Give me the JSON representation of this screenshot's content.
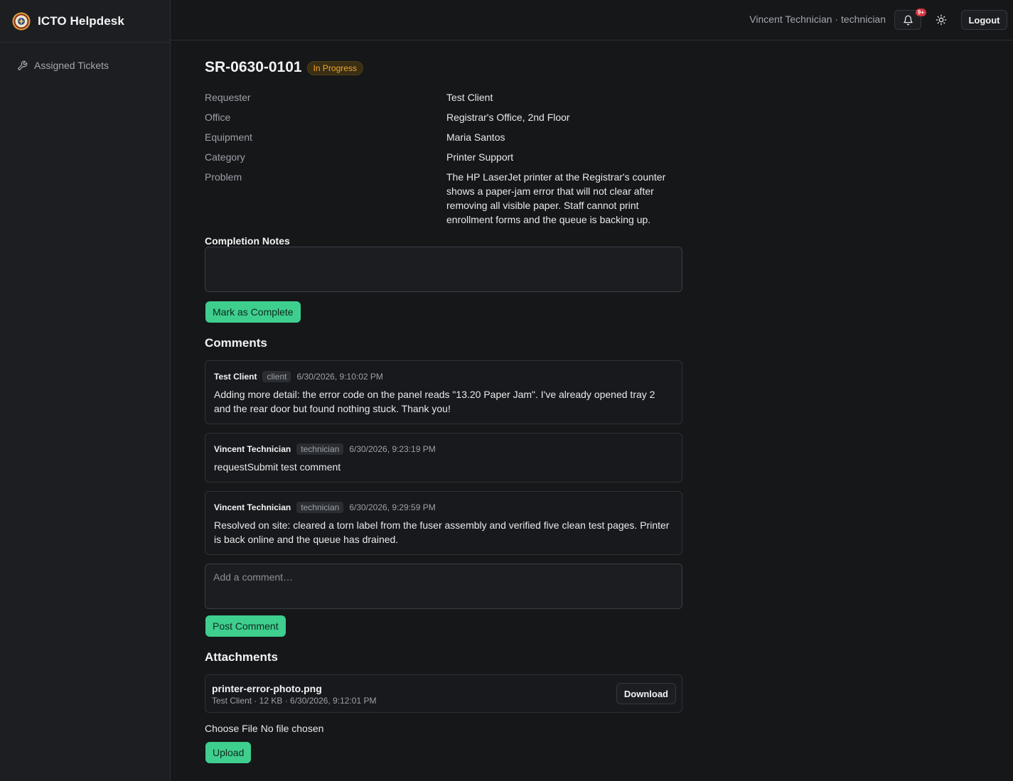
{
  "app": {
    "name": "ICTO Helpdesk"
  },
  "sidebar": {
    "items": [
      {
        "label": "Assigned Tickets",
        "icon": "wrench-icon"
      }
    ]
  },
  "header": {
    "user_label": "Vincent Technician · technician",
    "notification_badge": "9+",
    "logout_label": "Logout"
  },
  "ticket": {
    "id": "SR-0630-0101",
    "status": "In Progress",
    "status_color": "#f0a52b",
    "fields": [
      {
        "label": "Requester",
        "value": "Test Client"
      },
      {
        "label": "Office",
        "value": "Registrar's Office, 2nd Floor"
      },
      {
        "label": "Equipment",
        "value": "Maria Santos"
      },
      {
        "label": "Category",
        "value": "Printer Support"
      },
      {
        "label": "Problem",
        "value": "The HP LaserJet printer at the Registrar's counter shows a paper-jam error that will not clear after removing all visible paper. Staff cannot print enrollment forms and the queue is backing up."
      }
    ]
  },
  "completion": {
    "label": "Completion Notes",
    "value": "",
    "button_label": "Mark as Complete"
  },
  "comments": {
    "title": "Comments",
    "items": [
      {
        "author": "Test Client",
        "role": "client",
        "time": "6/30/2026, 9:10:02 PM",
        "body": "Adding more detail: the error code on the panel reads \"13.20 Paper Jam\". I've already opened tray 2 and the rear door but found nothing stuck. Thank you!"
      },
      {
        "author": "Vincent Technician",
        "role": "technician",
        "time": "6/30/2026, 9:23:19 PM",
        "body": "requestSubmit test comment"
      },
      {
        "author": "Vincent Technician",
        "role": "technician",
        "time": "6/30/2026, 9:29:59 PM",
        "body": "Resolved on site: cleared a torn label from the fuser assembly and verified five clean test pages. Printer is back online and the queue has drained."
      }
    ],
    "input_placeholder": "Add a comment…",
    "post_label": "Post Comment"
  },
  "attachments": {
    "title": "Attachments",
    "items": [
      {
        "name": "printer-error-photo.png",
        "meta": "Test Client · 12 KB · 6/30/2026, 9:12:01 PM",
        "download_label": "Download"
      }
    ],
    "choose_file_label": "Choose File",
    "no_file_label": "No file chosen",
    "upload_label": "Upload"
  },
  "colors": {
    "accent_green": "#3ecf8e",
    "background": "#151719",
    "sidebar": "#1c1e21",
    "badge_red": "#d4333b"
  }
}
